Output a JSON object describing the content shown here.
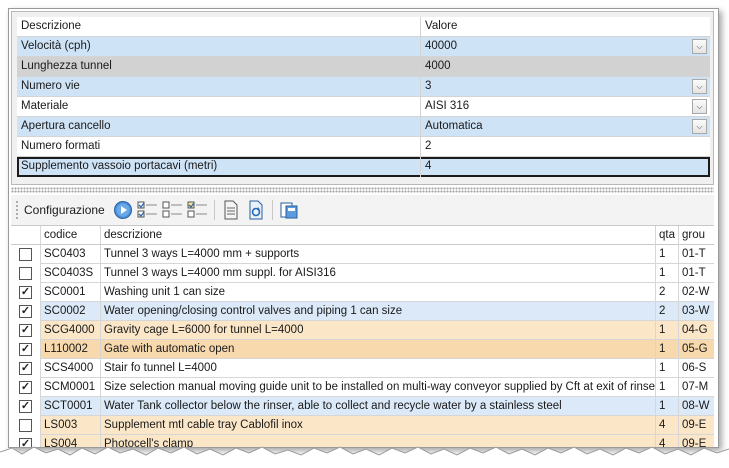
{
  "properties": {
    "header": {
      "name": "Descrizione",
      "value": "Valore"
    },
    "rows": [
      {
        "name": "Velocità (cph)",
        "value": "40000"
      },
      {
        "name": "Lunghezza tunnel",
        "value": "4000"
      },
      {
        "name": "Numero vie",
        "value": "3"
      },
      {
        "name": "Materiale",
        "value": "AISI 316"
      },
      {
        "name": "Apertura cancello",
        "value": "Automatica"
      },
      {
        "name": "Numero  formati",
        "value": "2"
      },
      {
        "name": "Supplemento vassoio portacavi (metri)",
        "value": "4"
      }
    ],
    "dropdown_glyph": "⌵"
  },
  "toolbar": {
    "label": "Configurazione"
  },
  "grid": {
    "columns": {
      "check": "",
      "code": "codice",
      "description": "descrizione",
      "qty": "qta",
      "group": "grou"
    },
    "rows": [
      {
        "checked": false,
        "code": "SC0403",
        "description": "Tunnel 3 ways L=4000 mm + supports",
        "qty": "1",
        "group": "01-T"
      },
      {
        "checked": false,
        "code": "SC0403S",
        "description": "Tunnel 3 ways L=4000 mm suppl. for AISI316",
        "qty": "1",
        "group": "01-T"
      },
      {
        "checked": true,
        "code": "SC0001",
        "description": "Washing unit 1 can size",
        "qty": "2",
        "group": "02-W"
      },
      {
        "checked": true,
        "code": "SC0002",
        "description": "Water opening/closing control valves and piping 1 can size",
        "qty": "2",
        "group": "03-W"
      },
      {
        "checked": true,
        "code": "SCG4000",
        "description": "Gravity cage L=6000 for tunnel L=4000",
        "qty": "1",
        "group": "04-G"
      },
      {
        "checked": true,
        "code": "L110002",
        "description": "Gate with automatic open",
        "qty": "1",
        "group": "05-G"
      },
      {
        "checked": true,
        "code": "SCS4000",
        "description": "Stair fo tunnel L=4000",
        "qty": "1",
        "group": "06-S"
      },
      {
        "checked": true,
        "code": "SCM0001",
        "description": "Size selection manual moving guide unit to be installed on multi-way conveyor supplied by Cft at exit of rinser",
        "qty": "1",
        "group": "07-M"
      },
      {
        "checked": true,
        "code": "SCT0001",
        "description": "Water Tank collector below the rinser, able to collect and recycle water by a stainless steel",
        "qty": "1",
        "group": "08-W"
      },
      {
        "checked": false,
        "code": "LS003",
        "description": "Supplement mtl cable tray Cablofil inox",
        "qty": "4",
        "group": "09-E"
      },
      {
        "checked": true,
        "code": "LS004",
        "description": "Photocell's clamp",
        "qty": "4",
        "group": "09-E"
      }
    ],
    "check_glyph": "✓"
  },
  "colors": {
    "selection_blue": "#cfe3f7",
    "orange_row": "#fbe7c8",
    "blue_row": "#dbe9f8"
  }
}
